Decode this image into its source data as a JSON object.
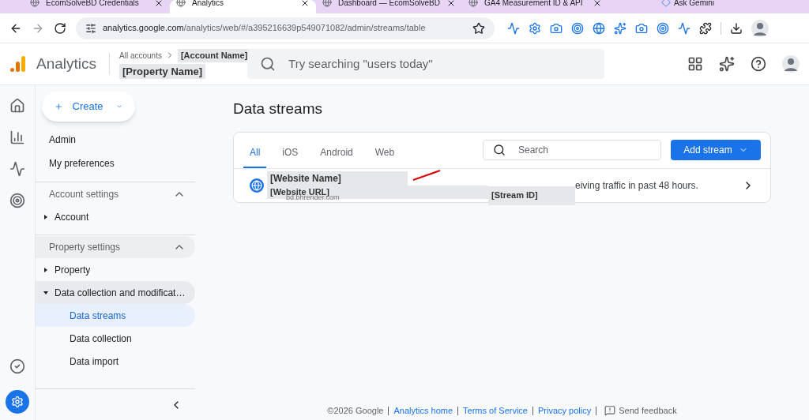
{
  "browser": {
    "tabs": [
      {
        "title": "EcomSolveBD Credentials",
        "selected": false
      },
      {
        "title": "Analytics",
        "selected": true
      },
      {
        "title": "Dashboard — EcomSolveBD",
        "selected": false
      },
      {
        "title": "GA4 Measurement ID & API",
        "selected": false
      }
    ],
    "gemini": "Ask Gemini",
    "url_host": "analytics.google.com",
    "url_path": "/analytics/web/#/a395216639p549071082/admin/streams/table"
  },
  "header": {
    "product": "Analytics",
    "breadcrumb": "All accounts",
    "account": "[Account Name]",
    "property": "[Property Name]",
    "search_placeholder": "Try searching \"users today\""
  },
  "sidebar": {
    "create": "Create",
    "items": [
      {
        "kind": "link",
        "label": "Admin"
      },
      {
        "kind": "link",
        "label": "My preferences"
      },
      {
        "kind": "section",
        "label": "Account settings",
        "expanded": true,
        "highlighted": false
      },
      {
        "kind": "node",
        "label": "Account",
        "expanded": false
      },
      {
        "kind": "section",
        "label": "Property settings",
        "expanded": true,
        "highlighted": true
      },
      {
        "kind": "node",
        "label": "Property",
        "expanded": false
      },
      {
        "kind": "node",
        "label": "Data collection and modificat…",
        "expanded": true
      },
      {
        "kind": "child",
        "label": "Data streams",
        "selected": true
      },
      {
        "kind": "child",
        "label": "Data collection",
        "selected": false
      },
      {
        "kind": "child",
        "label": "Data import",
        "selected": false
      }
    ]
  },
  "main": {
    "title": "Data streams",
    "tabs": [
      {
        "label": "All",
        "selected": true
      },
      {
        "label": "iOS",
        "selected": false
      },
      {
        "label": "Android",
        "selected": false
      },
      {
        "label": "Web",
        "selected": false
      }
    ],
    "search_placeholder": "Search",
    "add_button": "Add stream",
    "streams": [
      {
        "name": "[Website Name]",
        "url": "[Website URL]",
        "url_behind": "bd.bhrender.com",
        "stream_id": "[Stream ID]",
        "status": "eiving traffic in past 48 hours."
      }
    ]
  },
  "footer": {
    "copyright": "©2026 Google",
    "links": [
      "Analytics home",
      "Terms of Service",
      "Privacy policy"
    ],
    "feedback": "Send feedback"
  }
}
